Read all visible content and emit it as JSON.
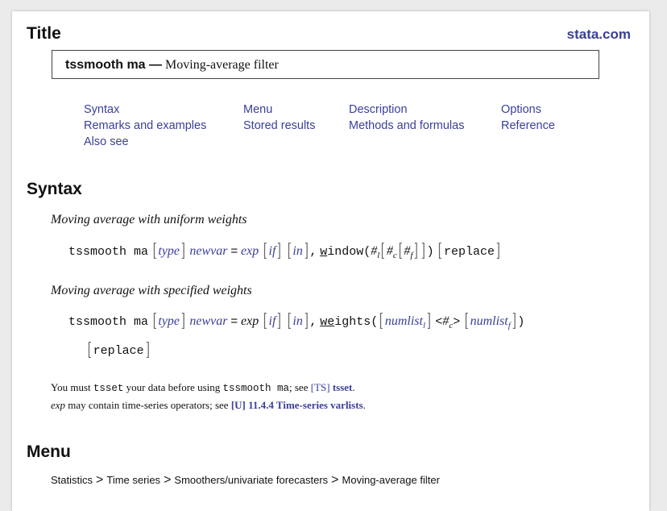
{
  "header": {
    "title": "Title",
    "brand": "stata.com"
  },
  "entry": {
    "command": "tssmooth ma —",
    "description": "Moving-average filter"
  },
  "toc": {
    "syntax": "Syntax",
    "menu": "Menu",
    "description": "Description",
    "options": "Options",
    "remarks": "Remarks and examples",
    "stored": "Stored results",
    "methods": "Methods and formulas",
    "reference": "Reference",
    "also_see": "Also see"
  },
  "syntax": {
    "heading": "Syntax",
    "uniform_heading": "Moving average with uniform weights",
    "specified_heading": "Moving average with specified weights",
    "cmd": "tssmooth ma",
    "type": "type",
    "newvar": "newvar",
    "eq": "=",
    "exp": "exp",
    "if": "if",
    "in": "in",
    "comma": ",",
    "window_u": "w",
    "window_rest": "indow(",
    "l": "l",
    "c": "c",
    "f": "f",
    "hash": "#",
    "close2": ")",
    "replace": "replace",
    "weights_u": "we",
    "weights_rest": "ights(",
    "numlist": "numlist",
    "lt": "<",
    "gt": ">",
    "close1": ")"
  },
  "notes": {
    "line1_a": "You must",
    "tsset_cmd": "tsset",
    "line1_b": "your data before using",
    "line1_cmd": "tssmooth ma",
    "line1_c": "; see",
    "ts_ref": "[TS]",
    "tsset_link": "tsset",
    "period": ".",
    "exp": "exp",
    "line2_a": "may contain time-series operators; see",
    "u_ref": "[U]",
    "u_link": "11.4.4 Time-series varlists",
    "period2": "."
  },
  "menu": {
    "heading": "Menu",
    "path": [
      "Statistics",
      "Time series",
      "Smoothers/univariate forecasters",
      "Moving-average filter"
    ],
    "separator": ">"
  }
}
